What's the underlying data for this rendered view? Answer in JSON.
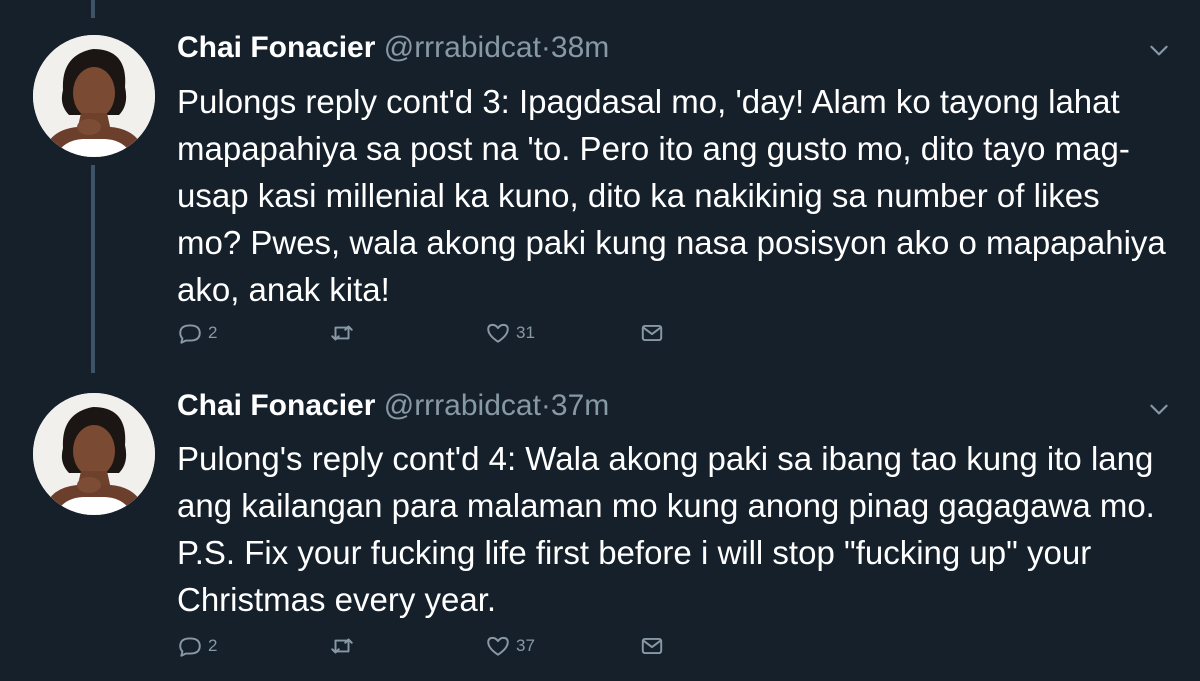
{
  "tweets": [
    {
      "name": "Chai Fonacier",
      "handle": "@rrrabidcat",
      "separator": "·",
      "time": "38m",
      "text": "Pulongs reply cont'd 3: Ipagdasal mo, 'day! Alam ko tayong lahat mapapahiya sa post na 'to. Pero ito ang gusto mo, dito tayo mag-usap kasi millenial ka kuno, dito ka nakikinig sa number of likes mo? Pwes, wala akong paki kung nasa posisyon ako o mapapahiya ako, anak kita!",
      "replies": "2",
      "retweets": "",
      "likes": "31"
    },
    {
      "name": "Chai Fonacier",
      "handle": "@rrrabidcat",
      "separator": "·",
      "time": "37m",
      "text": "Pulong's reply cont'd 4: Wala akong paki sa ibang tao kung ito lang ang kailangan para malaman mo kung anong pinag gagagawa mo. P.S. Fix your fucking life first before i will stop \"fucking up\" your Christmas every year.",
      "replies": "2",
      "retweets": "",
      "likes": "37"
    }
  ],
  "colors": {
    "background": "#15202b",
    "text": "#ffffff",
    "secondary": "#8899a6",
    "thread_line": "#3d5466"
  }
}
